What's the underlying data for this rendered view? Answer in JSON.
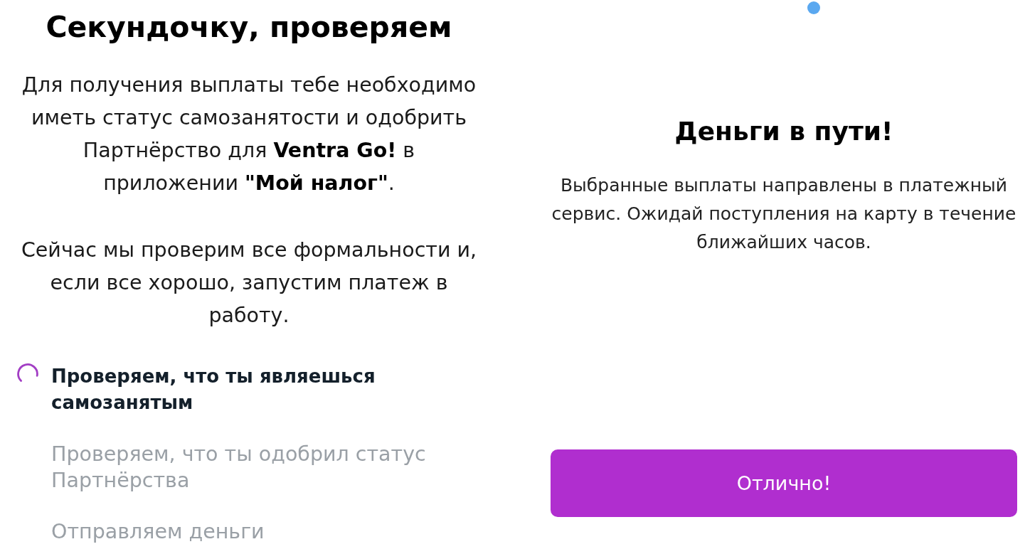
{
  "checking_screen": {
    "title": "Секундочку, проверяем",
    "paragraphs": [
      "Для получения выплаты тебе необходимо иметь статус самозанятости и одобрить Партнёрство для **Ventra Go!** в приложении **\"Мой налог\"**.",
      "Сейчас мы проверим все формальности и, если все хорошо, запустим платеж в работу."
    ],
    "steps": [
      {
        "label": "Проверяем, что ты являешься самозанятым",
        "active": true
      },
      {
        "label": "Проверяем, что ты одобрил статус Партнёрства",
        "active": false
      },
      {
        "label": "Отправляем деньги",
        "active": false
      }
    ]
  },
  "success_screen": {
    "title": "Деньги в пути!",
    "text": "Выбранные выплаты направлены в платежный сервис. Ожидай поступления на карту в течение ближайших часов.",
    "button": "Отлично!"
  }
}
